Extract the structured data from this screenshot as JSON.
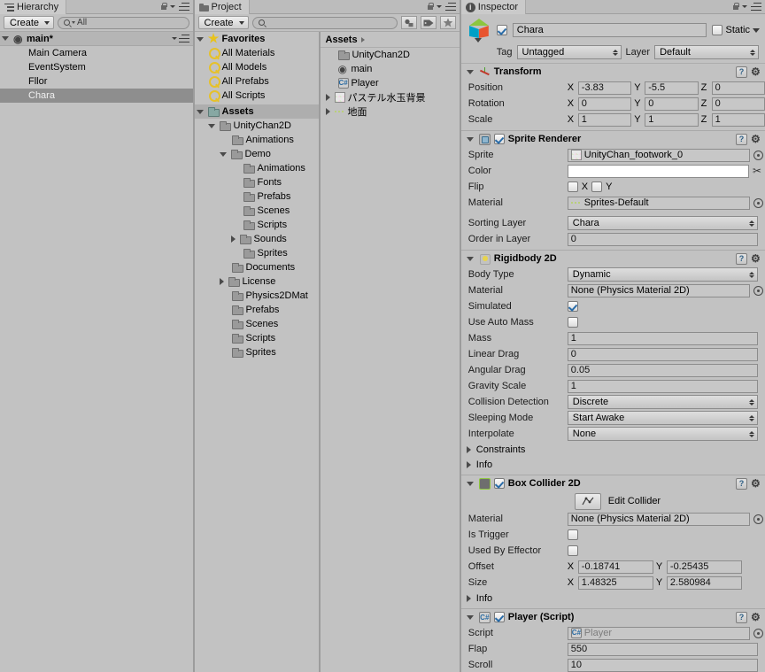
{
  "panels": {
    "hierarchy": {
      "tab_label": "Hierarchy",
      "create_label": "Create",
      "search_placeholder": "All",
      "scene_name": "main*",
      "items": [
        {
          "label": "Main Camera",
          "selected": false
        },
        {
          "label": "EventSystem",
          "selected": false
        },
        {
          "label": "Fllor",
          "selected": false
        },
        {
          "label": "Chara",
          "selected": true
        }
      ]
    },
    "project": {
      "tab_label": "Project",
      "create_label": "Create",
      "search_placeholder": "",
      "favorites_label": "Favorites",
      "favorites": [
        {
          "label": "All Materials"
        },
        {
          "label": "All Models"
        },
        {
          "label": "All Prefabs"
        },
        {
          "label": "All Scripts"
        }
      ],
      "assets_root_label": "Assets",
      "tree": [
        {
          "label": "UnityChan2D",
          "indent": 1,
          "fold": "down"
        },
        {
          "label": "Animations",
          "indent": 2,
          "fold": "none"
        },
        {
          "label": "Demo",
          "indent": 2,
          "fold": "down"
        },
        {
          "label": "Animations",
          "indent": 3,
          "fold": "none"
        },
        {
          "label": "Fonts",
          "indent": 3,
          "fold": "none"
        },
        {
          "label": "Prefabs",
          "indent": 3,
          "fold": "none"
        },
        {
          "label": "Scenes",
          "indent": 3,
          "fold": "none"
        },
        {
          "label": "Scripts",
          "indent": 3,
          "fold": "none"
        },
        {
          "label": "Sounds",
          "indent": 3,
          "fold": "right"
        },
        {
          "label": "Sprites",
          "indent": 3,
          "fold": "none"
        },
        {
          "label": "Documents",
          "indent": 2,
          "fold": "none"
        },
        {
          "label": "License",
          "indent": 2,
          "fold": "right"
        },
        {
          "label": "Physics2DMat",
          "indent": 2,
          "fold": "none"
        },
        {
          "label": "Prefabs",
          "indent": 2,
          "fold": "none"
        },
        {
          "label": "Scenes",
          "indent": 2,
          "fold": "none"
        },
        {
          "label": "Scripts",
          "indent": 2,
          "fold": "none"
        },
        {
          "label": "Sprites",
          "indent": 2,
          "fold": "none"
        }
      ],
      "breadcrumb_label": "Assets",
      "contents": [
        {
          "label": "UnityChan2D",
          "icon": "folder-icon",
          "fold": "none"
        },
        {
          "label": "main",
          "icon": "unity-scene-icon",
          "fold": "none"
        },
        {
          "label": "Player",
          "icon": "csharp-script-icon",
          "fold": "none"
        },
        {
          "label": "パステル水玉背景",
          "icon": "sprite-icon",
          "fold": "right"
        },
        {
          "label": "地面",
          "icon": "sprite-strip-icon",
          "fold": "right"
        }
      ]
    },
    "inspector": {
      "tab_label": "Inspector",
      "object_name": "Chara",
      "enabled": true,
      "static_label": "Static",
      "static_checked": false,
      "tag_label": "Tag",
      "tag_value": "Untagged",
      "layer_label": "Layer",
      "layer_value": "Default",
      "components": [
        {
          "title": "Transform",
          "icon": "transform-icon",
          "has_checkbox": false,
          "rows": [
            {
              "type": "vector3",
              "label": "Position",
              "x": "-3.83",
              "y": "-5.5",
              "z": "0"
            },
            {
              "type": "vector3",
              "label": "Rotation",
              "x": "0",
              "y": "0",
              "z": "0"
            },
            {
              "type": "vector3",
              "label": "Scale",
              "x": "1",
              "y": "1",
              "z": "1"
            }
          ]
        },
        {
          "title": "Sprite Renderer",
          "icon": "sprite-renderer-icon",
          "has_checkbox": true,
          "checked": true,
          "rows": [
            {
              "type": "object",
              "label": "Sprite",
              "value": "UnityChan_footwork_0",
              "icon": "sprite-icon"
            },
            {
              "type": "color",
              "label": "Color",
              "value": "#ffffff"
            },
            {
              "type": "flip",
              "label": "Flip",
              "x_label": "X",
              "y_label": "Y",
              "x": false,
              "y": false
            },
            {
              "type": "object",
              "label": "Material",
              "value": "Sprites-Default",
              "icon": "material-icon"
            },
            {
              "type": "gap"
            },
            {
              "type": "dropdown",
              "label": "Sorting Layer",
              "value": "Chara"
            },
            {
              "type": "text",
              "label": "Order in Layer",
              "value": "0"
            }
          ]
        },
        {
          "title": "Rigidbody 2D",
          "icon": "rigidbody2d-icon",
          "has_checkbox": false,
          "rows": [
            {
              "type": "dropdown",
              "label": "Body Type",
              "value": "Dynamic"
            },
            {
              "type": "object",
              "label": "Material",
              "value": "None (Physics Material 2D)"
            },
            {
              "type": "checkbox",
              "label": "Simulated",
              "checked": true
            },
            {
              "type": "checkbox",
              "label": "Use Auto Mass",
              "checked": false
            },
            {
              "type": "text",
              "label": "Mass",
              "value": "1"
            },
            {
              "type": "text",
              "label": "Linear Drag",
              "value": "0"
            },
            {
              "type": "text",
              "label": "Angular Drag",
              "value": "0.05"
            },
            {
              "type": "text",
              "label": "Gravity Scale",
              "value": "1"
            },
            {
              "type": "dropdown",
              "label": "Collision Detection",
              "value": "Discrete"
            },
            {
              "type": "dropdown",
              "label": "Sleeping Mode",
              "value": "Start Awake"
            },
            {
              "type": "dropdown",
              "label": "Interpolate",
              "value": "None"
            },
            {
              "type": "foldout",
              "label": "Constraints"
            },
            {
              "type": "foldout",
              "label": "Info"
            }
          ]
        },
        {
          "title": "Box Collider 2D",
          "icon": "box-collider-2d-icon",
          "has_checkbox": true,
          "checked": true,
          "rows": [
            {
              "type": "edit",
              "label": "Edit Collider"
            },
            {
              "type": "object",
              "label": "Material",
              "value": "None (Physics Material 2D)"
            },
            {
              "type": "checkbox",
              "label": "Is Trigger",
              "checked": false
            },
            {
              "type": "checkbox",
              "label": "Used By Effector",
              "checked": false
            },
            {
              "type": "vector2",
              "label": "Offset",
              "x": "-0.18741",
              "y": "-0.25435"
            },
            {
              "type": "vector2",
              "label": "Size",
              "x": "1.48325",
              "y": "2.580984"
            },
            {
              "type": "foldout",
              "label": "Info"
            }
          ]
        },
        {
          "title": "Player (Script)",
          "icon": "csharp-script-icon",
          "has_checkbox": true,
          "checked": true,
          "rows": [
            {
              "type": "object",
              "label": "Script",
              "value": "Player",
              "readonly": true,
              "icon": "csharp-script-icon"
            },
            {
              "type": "text",
              "label": "Flap",
              "value": "550"
            },
            {
              "type": "text",
              "label": "Scroll",
              "value": "10"
            }
          ]
        }
      ]
    }
  }
}
